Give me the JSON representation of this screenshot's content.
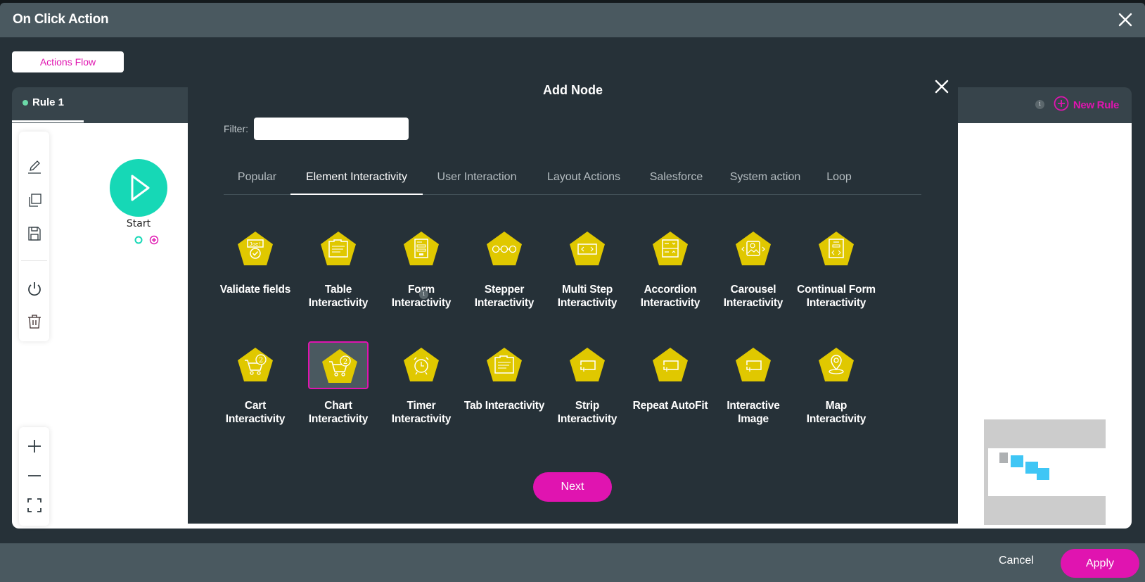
{
  "modal": {
    "title": "On Click Action",
    "close_icon": "close-icon"
  },
  "top_tab": {
    "label": "Actions Flow"
  },
  "rules": {
    "tabs": [
      {
        "label": "Rule 1",
        "status_color": "#6bd9a8"
      }
    ],
    "new_rule_label": "New Rule",
    "info_glyph": "i"
  },
  "canvas": {
    "toolbar": [
      "edit-icon",
      "duplicate-icon",
      "save-icon",
      "power-icon",
      "trash-icon"
    ],
    "zoom_controls": [
      "zoom-in-icon",
      "zoom-out-icon",
      "fit-screen-icon"
    ],
    "start_node": {
      "label": "Start",
      "color": "#16d8b6"
    }
  },
  "add_node": {
    "title": "Add Node",
    "filter": {
      "label": "Filter:",
      "value": "",
      "placeholder": ""
    },
    "tabs": [
      {
        "label": "Popular",
        "active": false
      },
      {
        "label": "Element Interactivity",
        "active": true
      },
      {
        "label": "User Interaction",
        "active": false
      },
      {
        "label": "Layout Actions",
        "active": false
      },
      {
        "label": "Salesforce",
        "active": false
      },
      {
        "label": "System action",
        "active": false
      },
      {
        "label": "Loop",
        "active": false
      }
    ],
    "items": [
      {
        "label": "Validate fields",
        "icon": "validate-fields-icon"
      },
      {
        "label": "Table Interactivity",
        "icon": "table-icon"
      },
      {
        "label": "Form Interactivity",
        "icon": "form-icon",
        "info": "i"
      },
      {
        "label": "Stepper Interactivity",
        "icon": "stepper-icon"
      },
      {
        "label": "Multi Step Interactivity",
        "icon": "multi-step-icon"
      },
      {
        "label": "Accordion Interactivity",
        "icon": "accordion-icon"
      },
      {
        "label": "Carousel Interactivity",
        "icon": "carousel-icon"
      },
      {
        "label": "Continual Form Interactivity",
        "icon": "continual-form-icon"
      },
      {
        "label": "Cart Interactivity",
        "icon": "cart-icon"
      },
      {
        "label": "Chart Interactivity",
        "icon": "cart-icon",
        "selected": true
      },
      {
        "label": "Timer Interactivity",
        "icon": "alarm-clock-icon"
      },
      {
        "label": "Tab Interactivity",
        "icon": "tab-folder-icon"
      },
      {
        "label": "Strip Interactivity",
        "icon": "strip-icon"
      },
      {
        "label": "Repeat AutoFit",
        "icon": "repeat-icon"
      },
      {
        "label": "Interactive Image",
        "icon": "interactive-image-icon"
      },
      {
        "label": "Map Interactivity",
        "icon": "map-pin-icon"
      }
    ],
    "next_label": "Next"
  },
  "footer": {
    "cancel_label": "Cancel",
    "apply_label": "Apply"
  },
  "colors": {
    "accent": "#e014b0",
    "node_icon": "#e0c800",
    "dark_bg": "#263138",
    "header_bg": "#4a5960",
    "minimap_node": "#3fc6f5"
  }
}
